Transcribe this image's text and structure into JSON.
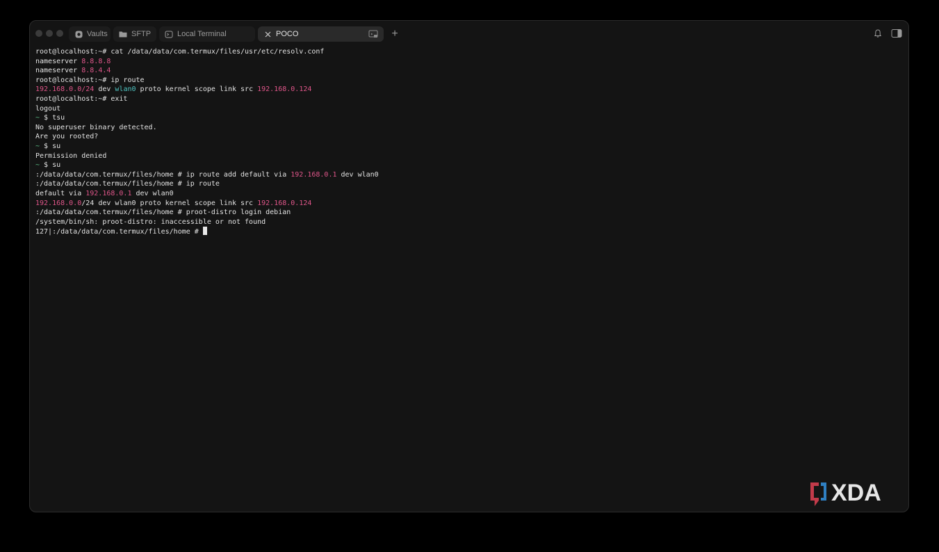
{
  "tabs": [
    {
      "label": "Vaults",
      "icon": "vault-icon"
    },
    {
      "label": "SFTP",
      "icon": "folder-icon"
    },
    {
      "label": "Local Terminal",
      "icon": "terminal-icon"
    },
    {
      "label": "POCO",
      "icon": "close-icon",
      "active": true
    }
  ],
  "toolbar": {
    "new_tab": "+",
    "icons": [
      "bell-icon",
      "sidebar-toggle-icon"
    ]
  },
  "terminal": {
    "lines": [
      {
        "segments": [
          {
            "text": "root@localhost:~# cat /data/data/com.termux/files/usr/etc/resolv.conf",
            "style": "plain"
          }
        ]
      },
      {
        "segments": [
          {
            "text": "nameserver ",
            "style": "plain"
          },
          {
            "text": "8.8.8.8",
            "style": "ip"
          }
        ]
      },
      {
        "segments": [
          {
            "text": "nameserver ",
            "style": "plain"
          },
          {
            "text": "8.8.4.4",
            "style": "ip"
          }
        ]
      },
      {
        "segments": [
          {
            "text": "root@localhost:~# ip route",
            "style": "plain"
          }
        ]
      },
      {
        "segments": [
          {
            "text": "192.168.0.0/24",
            "style": "ip"
          },
          {
            "text": " dev ",
            "style": "plain"
          },
          {
            "text": "wlan0",
            "style": "iface"
          },
          {
            "text": " proto kernel scope link src ",
            "style": "plain"
          },
          {
            "text": "192.168.0.124",
            "style": "ip"
          }
        ]
      },
      {
        "segments": [
          {
            "text": "root@localhost:~# exit",
            "style": "plain"
          }
        ]
      },
      {
        "segments": [
          {
            "text": "logout",
            "style": "plain"
          }
        ]
      },
      {
        "segments": [
          {
            "text": "~ ",
            "style": "prompt"
          },
          {
            "text": "$ tsu",
            "style": "plain"
          }
        ]
      },
      {
        "segments": [
          {
            "text": "No superuser binary detected.",
            "style": "plain"
          }
        ]
      },
      {
        "segments": [
          {
            "text": "Are you rooted?",
            "style": "plain"
          }
        ]
      },
      {
        "segments": [
          {
            "text": "~ ",
            "style": "prompt"
          },
          {
            "text": "$ su",
            "style": "plain"
          }
        ]
      },
      {
        "segments": [
          {
            "text": "Permission denied",
            "style": "plain"
          }
        ]
      },
      {
        "segments": [
          {
            "text": "~ ",
            "style": "prompt"
          },
          {
            "text": "$ su",
            "style": "plain"
          }
        ]
      },
      {
        "segments": [
          {
            "text": ":/data/data/com.termux/files/home # ip route add default via ",
            "style": "plain"
          },
          {
            "text": "192.168.0.1",
            "style": "ip"
          },
          {
            "text": " dev wlan0",
            "style": "plain"
          }
        ]
      },
      {
        "segments": [
          {
            "text": ":/data/data/com.termux/files/home # ip route",
            "style": "plain"
          }
        ]
      },
      {
        "segments": [
          {
            "text": "default via ",
            "style": "plain"
          },
          {
            "text": "192.168.0.1",
            "style": "ip"
          },
          {
            "text": " dev wlan0",
            "style": "plain"
          }
        ]
      },
      {
        "segments": [
          {
            "text": "192.168.0.0",
            "style": "ip"
          },
          {
            "text": "/24 dev wlan0 proto kernel scope link src ",
            "style": "plain"
          },
          {
            "text": "192.168.0.124",
            "style": "ip"
          }
        ]
      },
      {
        "segments": [
          {
            "text": ":/data/data/com.termux/files/home # proot-distro login debian",
            "style": "plain"
          }
        ]
      },
      {
        "segments": [
          {
            "text": "/system/bin/sh: proot-distro: inaccessible or not found",
            "style": "plain"
          }
        ]
      },
      {
        "segments": [
          {
            "text": "127|:/data/data/com.termux/files/home # ",
            "style": "plain"
          }
        ],
        "cursor": true
      }
    ]
  },
  "watermark": {
    "text": "XDA",
    "icon": "xda-logo-icon"
  },
  "colors": {
    "background": "#141414",
    "text": "#e3e3e3",
    "ip": "#e0568a",
    "iface": "#4fc3c0",
    "prompt": "#5bbf86",
    "active_tab": "#2a2a2a"
  }
}
